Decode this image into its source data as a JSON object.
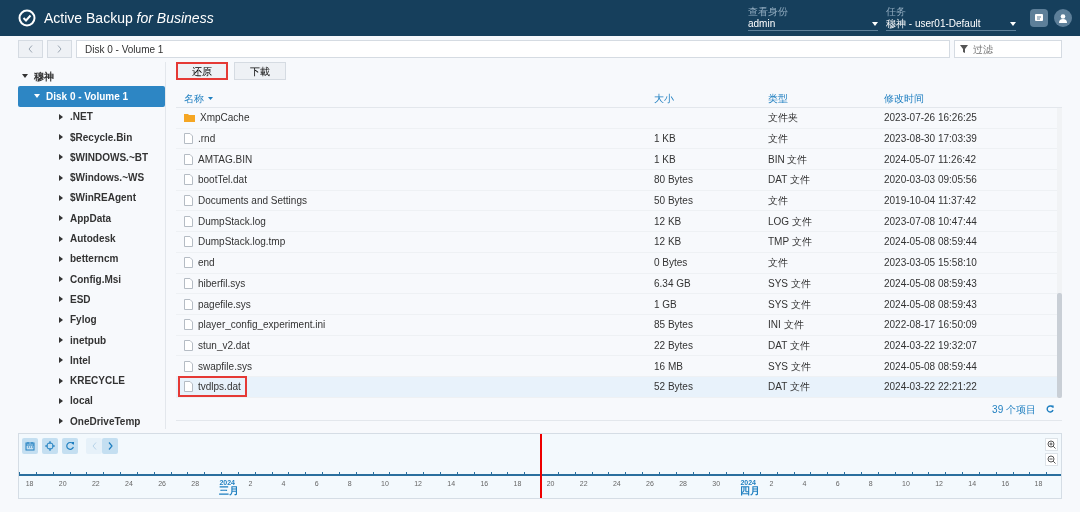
{
  "header": {
    "title": "Active Backup *for Business*",
    "identity": {
      "label": "查看身份",
      "value": "admin"
    },
    "task": {
      "label": "任务",
      "value": "穆神 - user01-Default"
    }
  },
  "path": {
    "value": "Disk 0 - Volume 1"
  },
  "filter": {
    "placeholder": "过滤"
  },
  "tree": [
    {
      "label": "穆神",
      "expanded": true,
      "selected": false,
      "children": [
        {
          "label": "Disk 0 - Volume 1",
          "expanded": true,
          "selected": true,
          "children": [
            {
              "label": ".NET",
              "expanded": false,
              "selected": false
            },
            {
              "label": "$Recycle.Bin",
              "expanded": false,
              "selected": false
            },
            {
              "label": "$WINDOWS.~BT",
              "expanded": false,
              "selected": false
            },
            {
              "label": "$Windows.~WS",
              "expanded": false,
              "selected": false
            },
            {
              "label": "$WinREAgent",
              "expanded": false,
              "selected": false
            },
            {
              "label": "AppData",
              "expanded": false,
              "selected": false
            },
            {
              "label": "Autodesk",
              "expanded": false,
              "selected": false
            },
            {
              "label": "betterncm",
              "expanded": false,
              "selected": false
            },
            {
              "label": "Config.Msi",
              "expanded": false,
              "selected": false
            },
            {
              "label": "ESD",
              "expanded": false,
              "selected": false
            },
            {
              "label": "Fylog",
              "expanded": false,
              "selected": false
            },
            {
              "label": "inetpub",
              "expanded": false,
              "selected": false
            },
            {
              "label": "Intel",
              "expanded": false,
              "selected": false
            },
            {
              "label": "KRECYCLE",
              "expanded": false,
              "selected": false
            },
            {
              "label": "local",
              "expanded": false,
              "selected": false
            },
            {
              "label": "OneDriveTemp",
              "expanded": false,
              "selected": false
            }
          ]
        }
      ]
    }
  ],
  "actions": [
    {
      "label": "还原",
      "highlighted": true
    },
    {
      "label": "下載",
      "highlighted": false
    }
  ],
  "table": {
    "columns": [
      "名称",
      "大小",
      "类型",
      "修改时间"
    ],
    "rows": [
      {
        "kind": "folder",
        "name": "XmpCache",
        "size": "",
        "type": "文件夹",
        "modified": "2023-07-26 16:26:25",
        "selected": false,
        "highlighted": false
      },
      {
        "kind": "file",
        "name": ".rnd",
        "size": "1 KB",
        "type": "文件",
        "modified": "2023-08-30 17:03:39",
        "selected": false,
        "highlighted": false
      },
      {
        "kind": "file",
        "name": "AMTAG.BIN",
        "size": "1 KB",
        "type": "BIN 文件",
        "modified": "2024-05-07 11:26:42",
        "selected": false,
        "highlighted": false
      },
      {
        "kind": "file",
        "name": "bootTel.dat",
        "size": "80 Bytes",
        "type": "DAT 文件",
        "modified": "2020-03-03 09:05:56",
        "selected": false,
        "highlighted": false
      },
      {
        "kind": "file",
        "name": "Documents and Settings",
        "size": "50 Bytes",
        "type": "文件",
        "modified": "2019-10-04 11:37:42",
        "selected": false,
        "highlighted": false
      },
      {
        "kind": "file",
        "name": "DumpStack.log",
        "size": "12 KB",
        "type": "LOG 文件",
        "modified": "2023-07-08 10:47:44",
        "selected": false,
        "highlighted": false
      },
      {
        "kind": "file",
        "name": "DumpStack.log.tmp",
        "size": "12 KB",
        "type": "TMP 文件",
        "modified": "2024-05-08 08:59:44",
        "selected": false,
        "highlighted": false
      },
      {
        "kind": "file",
        "name": "end",
        "size": "0 Bytes",
        "type": "文件",
        "modified": "2023-03-05 15:58:10",
        "selected": false,
        "highlighted": false
      },
      {
        "kind": "file",
        "name": "hiberfil.sys",
        "size": "6.34 GB",
        "type": "SYS 文件",
        "modified": "2024-05-08 08:59:43",
        "selected": false,
        "highlighted": false
      },
      {
        "kind": "file",
        "name": "pagefile.sys",
        "size": "1 GB",
        "type": "SYS 文件",
        "modified": "2024-05-08 08:59:43",
        "selected": false,
        "highlighted": false
      },
      {
        "kind": "file",
        "name": "player_config_experiment.ini",
        "size": "85 Bytes",
        "type": "INI 文件",
        "modified": "2022-08-17 16:50:09",
        "selected": false,
        "highlighted": false
      },
      {
        "kind": "file",
        "name": "stun_v2.dat",
        "size": "22 Bytes",
        "type": "DAT 文件",
        "modified": "2024-03-22 19:32:07",
        "selected": false,
        "highlighted": false
      },
      {
        "kind": "file",
        "name": "swapfile.sys",
        "size": "16 MB",
        "type": "SYS 文件",
        "modified": "2024-05-08 08:59:44",
        "selected": false,
        "highlighted": false
      },
      {
        "kind": "file",
        "name": "tvdlps.dat",
        "size": "52 Bytes",
        "type": "DAT 文件",
        "modified": "2024-03-22 22:21:22",
        "selected": true,
        "highlighted": true
      }
    ],
    "count": "39 个项目"
  },
  "timeline": {
    "marker": {
      "level": 0.5
    },
    "labels": [
      {
        "kind": "day",
        "text": "18"
      },
      {
        "kind": "day",
        "text": "20"
      },
      {
        "kind": "day",
        "text": "22"
      },
      {
        "kind": "day",
        "text": "24"
      },
      {
        "kind": "day",
        "text": "26"
      },
      {
        "kind": "day",
        "text": "28"
      },
      {
        "kind": "month",
        "text": "2024",
        "month": "三月"
      },
      {
        "kind": "day",
        "text": "2"
      },
      {
        "kind": "day",
        "text": "4"
      },
      {
        "kind": "day",
        "text": "6"
      },
      {
        "kind": "day",
        "text": "8"
      },
      {
        "kind": "day",
        "text": "10"
      },
      {
        "kind": "day",
        "text": "12"
      },
      {
        "kind": "day",
        "text": "14"
      },
      {
        "kind": "day",
        "text": "16"
      },
      {
        "kind": "day",
        "text": "18"
      },
      {
        "kind": "day",
        "text": "20"
      },
      {
        "kind": "day",
        "text": "22"
      },
      {
        "kind": "day",
        "text": "24"
      },
      {
        "kind": "day",
        "text": "26"
      },
      {
        "kind": "day",
        "text": "28"
      },
      {
        "kind": "day",
        "text": "30"
      },
      {
        "kind": "month",
        "text": "2024",
        "month": "四月"
      },
      {
        "kind": "day",
        "text": "2"
      },
      {
        "kind": "day",
        "text": "4"
      },
      {
        "kind": "day",
        "text": "6"
      },
      {
        "kind": "day",
        "text": "8"
      },
      {
        "kind": "day",
        "text": "10"
      },
      {
        "kind": "day",
        "text": "12"
      },
      {
        "kind": "day",
        "text": "14"
      },
      {
        "kind": "day",
        "text": "16"
      },
      {
        "kind": "day",
        "text": "18"
      }
    ]
  }
}
